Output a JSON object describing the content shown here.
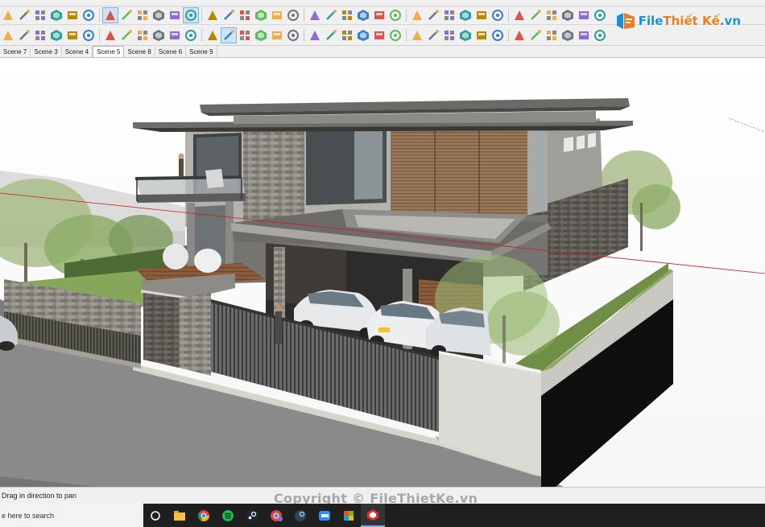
{
  "scenes": {
    "tabs": [
      "Scene 7",
      "Scene 3",
      "Scene 4",
      "Scene 5",
      "Scene 8",
      "Scene 6",
      "Scene 9"
    ],
    "active_index": 3
  },
  "logo": {
    "part1": "File",
    "part2": "Thiết Kế",
    "suffix": ".vn"
  },
  "status": {
    "hint": "Drag in direction to pan"
  },
  "watermark": "Copyright © FileThietKe.vn",
  "taskbar": {
    "search_placeholder": "e here to search",
    "apps": [
      "task-view",
      "file-explorer",
      "chrome",
      "spotify",
      "steam",
      "chrome-profile",
      "steam-client",
      "zoom",
      "teams",
      "sketchup"
    ]
  },
  "colors": {
    "toolbar_bg": "#f0f0f0",
    "active_tool": "#cfe3f7",
    "taskbar_bg": "#1f1f1f",
    "logo_blue": "#1d8fd6",
    "logo_orange": "#f27a1a"
  },
  "toolbar_row1_icons": [
    "select-icon",
    "eraser-icon",
    "line-icon",
    "paint-icon",
    "move-icon",
    "push-pull-icon",
    "rotate-icon",
    "scale-icon",
    "offset-icon",
    "tape-icon",
    "orbit-icon",
    "pan-icon",
    "zoom-icon",
    "zoom-extents-icon",
    "section-icon",
    "house-icon",
    "warehouse-icon",
    "home-icon",
    "barn-icon",
    "component-icon",
    "shadow-icon",
    "fog-icon",
    "style-icon",
    "materials-icon",
    "scenes-icon",
    "layers-icon",
    "outliner-icon",
    "eye-icon",
    "footprint-icon",
    "axes-icon",
    "position-camera-icon",
    "look-around-icon",
    "walk-icon",
    "geo-icon",
    "sandbox-icon",
    "photo-icon"
  ],
  "toolbar_row2_icons": [
    "pencil-icon",
    "arc-icon",
    "rectangle-icon",
    "circle-icon",
    "polygon-icon",
    "freehand-icon",
    "tape-measure-icon",
    "dimension-icon",
    "protractor-icon",
    "text-icon",
    "axes-tool-icon",
    "3d-text-icon",
    "orbit-tool-icon",
    "pan-tool-icon",
    "zoom-tool-icon",
    "zoom-window-icon",
    "ruby-icon",
    "extension-icon",
    "check-icon",
    "teapot-icon",
    "vray-icon",
    "light-icon",
    "camera-icon",
    "frame-icon",
    "lock-icon",
    "render-icon",
    "tent-icon",
    "cube-icon",
    "grass-icon",
    "fur-icon",
    "sun-icon",
    "arch-icon",
    "roof-icon",
    "stairs-icon",
    "spark-icon",
    "dome-icon"
  ]
}
